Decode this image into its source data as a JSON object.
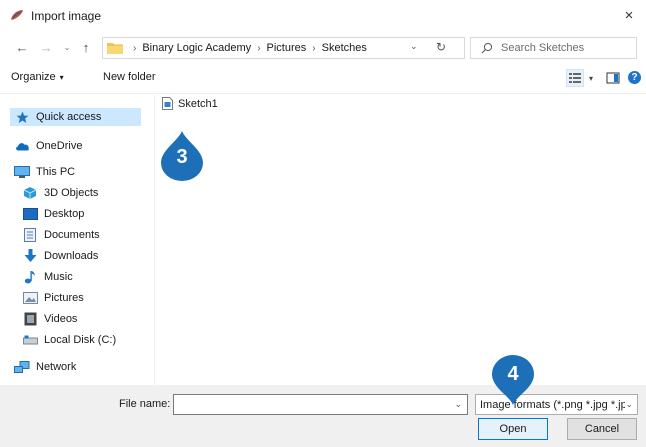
{
  "window": {
    "title": "Import image",
    "close_glyph": "×"
  },
  "nav": {
    "back_glyph": "←",
    "forward_glyph": "→",
    "recent_glyph": "⌄",
    "up_glyph": "↑"
  },
  "address": {
    "separator": "›",
    "crumbs": [
      "Binary Logic Academy",
      "Pictures",
      "Sketches"
    ],
    "dropdown_glyph": "⌄",
    "refresh_glyph": "↻"
  },
  "search": {
    "placeholder": "Search Sketches",
    "value": ""
  },
  "toolbar": {
    "organize_label": "Organize",
    "organize_caret": "▾",
    "new_folder_label": "New folder",
    "view_dropdown_glyph": "▾",
    "help_glyph": "?"
  },
  "sidebar": {
    "items": [
      {
        "label": "Quick access",
        "icon": "star-icon"
      },
      {
        "label": "OneDrive",
        "icon": "cloud-icon"
      },
      {
        "label": "This PC",
        "icon": "monitor-icon"
      },
      {
        "label": "3D Objects",
        "icon": "cube-icon"
      },
      {
        "label": "Desktop",
        "icon": "desktop-icon"
      },
      {
        "label": "Documents",
        "icon": "document-icon"
      },
      {
        "label": "Downloads",
        "icon": "download-icon"
      },
      {
        "label": "Music",
        "icon": "music-icon"
      },
      {
        "label": "Pictures",
        "icon": "pictures-icon"
      },
      {
        "label": "Videos",
        "icon": "video-icon"
      },
      {
        "label": "Local Disk (C:)",
        "icon": "disk-icon"
      },
      {
        "label": "Network",
        "icon": "network-icon"
      }
    ]
  },
  "files": [
    {
      "name": "Sketch1",
      "icon": "sketch-file-icon"
    }
  ],
  "annotations": {
    "marker_3": "3",
    "marker_4": "4"
  },
  "bottom": {
    "file_name_label": "File name:",
    "file_name_value": "",
    "dropdown_glyph": "⌄",
    "filter_label": "Image formats (*.png *.jpg *.jp",
    "open_label": "Open",
    "cancel_label": "Cancel"
  },
  "colors": {
    "accent": "#0078d7",
    "selection": "#cce8ff",
    "marker": "#1d6fb8",
    "panel": "#f0f0f0"
  }
}
